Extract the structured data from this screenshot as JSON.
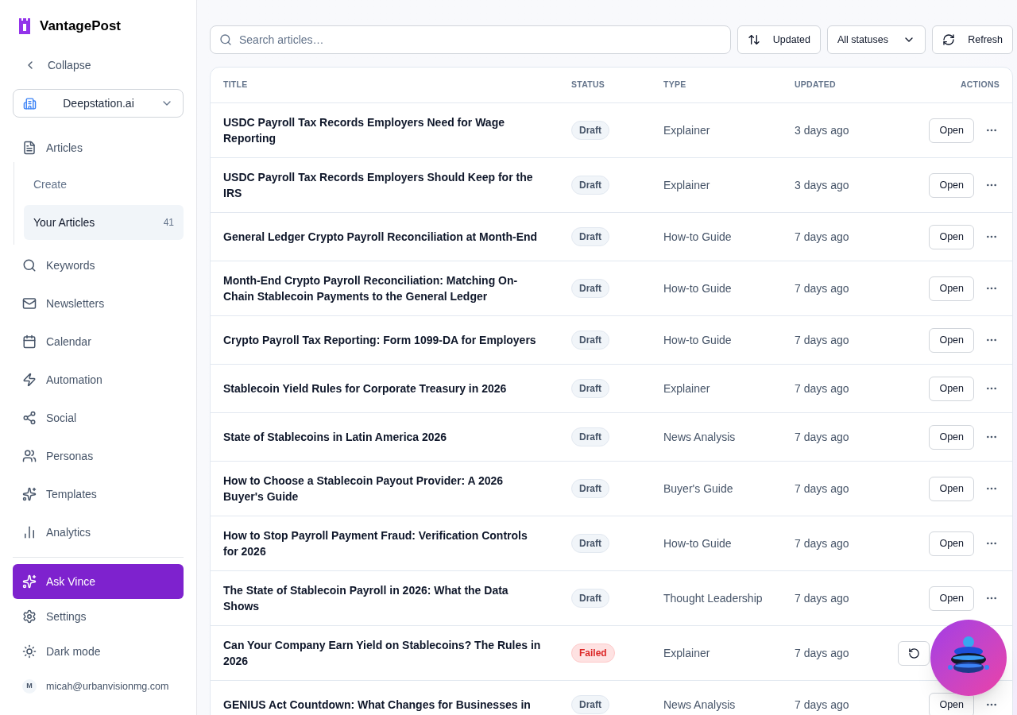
{
  "sidebar": {
    "brand": "VantagePost",
    "collapse": "Collapse",
    "workspace": "Deepstation.ai",
    "articles": {
      "label": "Articles",
      "children": [
        {
          "label": "Create",
          "selected": false
        },
        {
          "label": "Your Articles",
          "selected": true,
          "count": "41"
        }
      ]
    },
    "items": [
      "Keywords",
      "Newsletters",
      "Calendar",
      "Automation",
      "Social",
      "Personas",
      "Templates",
      "Analytics"
    ],
    "ask": "Ask Vince",
    "settings": "Settings",
    "dark_mode": "Dark mode",
    "user": {
      "initial": "M",
      "email": "micah@urbanvisionmg.com"
    }
  },
  "toolbar": {
    "search": {
      "placeholder": "Search articles…"
    },
    "sort": "Updated",
    "filter": "All statuses",
    "refresh": "Refresh"
  },
  "table": {
    "columns": [
      "TITLE",
      "STATUS",
      "TYPE",
      "UPDATED",
      "ACTIONS"
    ],
    "rows": [
      {
        "title": "USDC Payroll Tax Records Employers Need for Wage Reporting",
        "status": "Draft",
        "failed": false,
        "type": "Explainer",
        "updated": "3 days ago",
        "action": {
          "kind": "open",
          "label": "Open"
        }
      },
      {
        "title": "USDC Payroll Tax Records Employers Should Keep for the IRS",
        "status": "Draft",
        "failed": false,
        "type": "Explainer",
        "updated": "3 days ago",
        "action": {
          "kind": "open",
          "label": "Open"
        }
      },
      {
        "title": "General Ledger Crypto Payroll Reconciliation at Month-End",
        "status": "Draft",
        "failed": false,
        "type": "How-to Guide",
        "updated": "7 days ago",
        "action": {
          "kind": "open",
          "label": "Open"
        }
      },
      {
        "title": "Month-End Crypto Payroll Reconciliation: Matching On-Chain Stablecoin Payments to the General Ledger",
        "status": "Draft",
        "failed": false,
        "type": "How-to Guide",
        "updated": "7 days ago",
        "action": {
          "kind": "open",
          "label": "Open"
        }
      },
      {
        "title": "Crypto Payroll Tax Reporting: Form 1099-DA for Employers",
        "status": "Draft",
        "failed": false,
        "type": "How-to Guide",
        "updated": "7 days ago",
        "action": {
          "kind": "open",
          "label": "Open"
        }
      },
      {
        "title": "Stablecoin Yield Rules for Corporate Treasury in 2026",
        "status": "Draft",
        "failed": false,
        "type": "Explainer",
        "updated": "7 days ago",
        "action": {
          "kind": "open",
          "label": "Open"
        }
      },
      {
        "title": "State of Stablecoins in Latin America 2026",
        "status": "Draft",
        "failed": false,
        "type": "News Analysis",
        "updated": "7 days ago",
        "action": {
          "kind": "open",
          "label": "Open"
        }
      },
      {
        "title": "How to Choose a Stablecoin Payout Provider: A 2026 Buyer's Guide",
        "status": "Draft",
        "failed": false,
        "type": "Buyer's Guide",
        "updated": "7 days ago",
        "action": {
          "kind": "open",
          "label": "Open"
        }
      },
      {
        "title": "How to Stop Payroll Payment Fraud: Verification Controls for 2026",
        "status": "Draft",
        "failed": false,
        "type": "How-to Guide",
        "updated": "7 days ago",
        "action": {
          "kind": "open",
          "label": "Open"
        }
      },
      {
        "title": "The State of Stablecoin Payroll in 2026: What the Data Shows",
        "status": "Draft",
        "failed": false,
        "type": "Thought Leadership",
        "updated": "7 days ago",
        "action": {
          "kind": "open",
          "label": "Open"
        }
      },
      {
        "title": "Can Your Company Earn Yield on Stablecoins? The Rules in 2026",
        "status": "Failed",
        "failed": true,
        "type": "Explainer",
        "updated": "7 days ago",
        "action": {
          "kind": "retry"
        }
      },
      {
        "title": "GENIUS Act Countdown: What Changes for Businesses in",
        "status": "Draft",
        "failed": false,
        "type": "News Analysis",
        "updated": "7 days ago",
        "action": {
          "kind": "open",
          "label": "Open"
        }
      }
    ]
  }
}
